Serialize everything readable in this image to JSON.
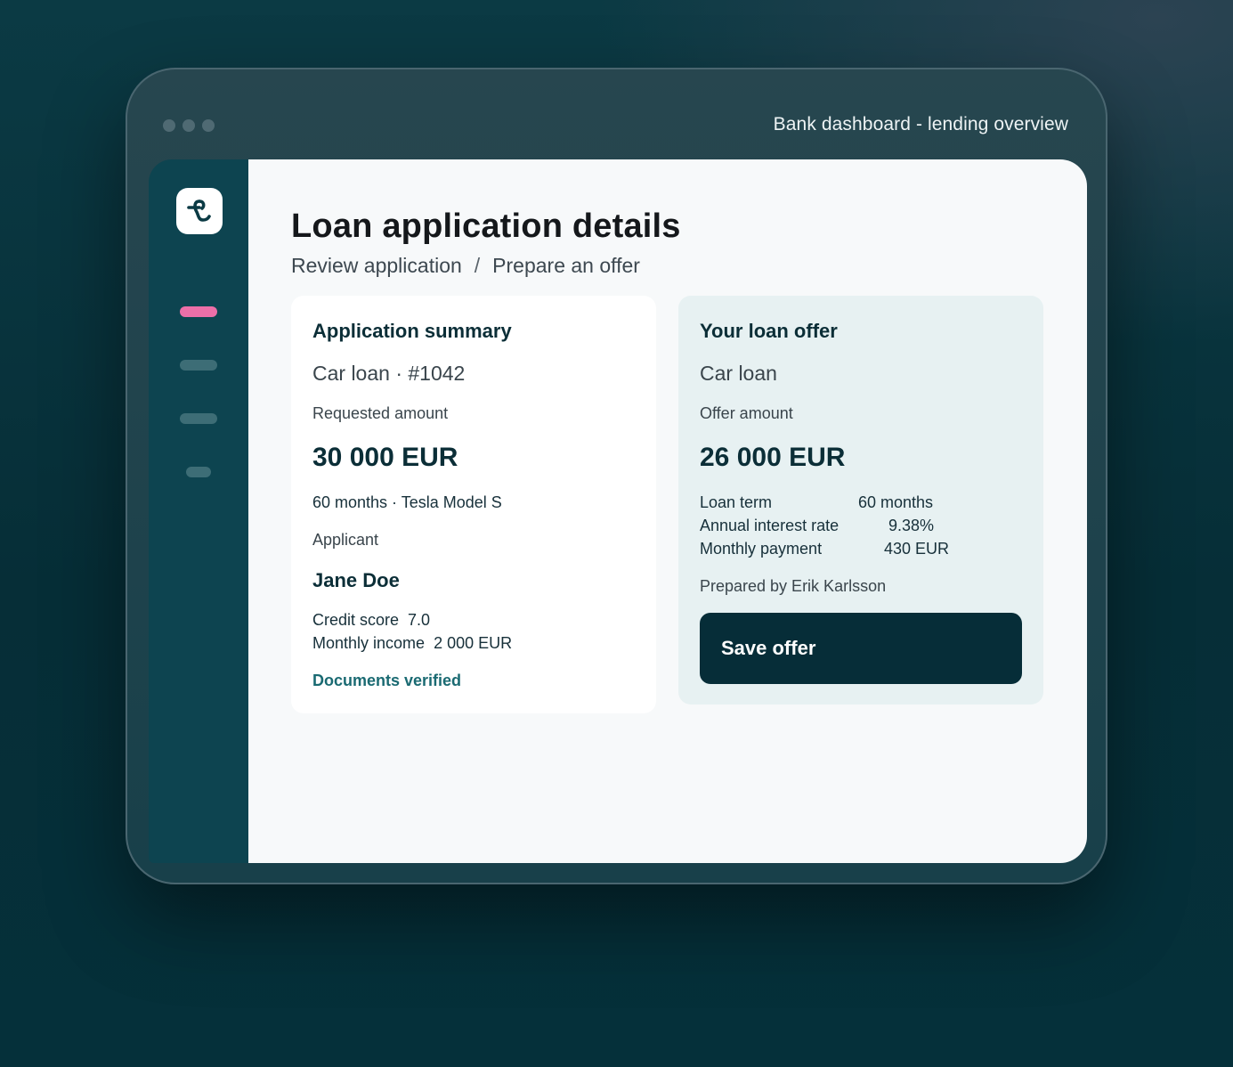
{
  "window": {
    "title": "Bank dashboard - lending overview"
  },
  "sidebar": {
    "logo_icon": "brand-logo-icon",
    "nav_items": [
      {
        "name": "nav-item-1",
        "active": true,
        "color": "#ec6fa8"
      },
      {
        "name": "nav-item-2",
        "active": false,
        "color": "#3d6d76"
      },
      {
        "name": "nav-item-3",
        "active": false,
        "color": "#3d6d76"
      },
      {
        "name": "nav-item-4",
        "active": false,
        "color": "#3d6d76"
      }
    ]
  },
  "page": {
    "title": "Loan application details",
    "breadcrumb": {
      "step1": "Review application",
      "separator": "/",
      "step2": "Prepare an offer"
    }
  },
  "summary": {
    "title": "Application summary",
    "loan_ref": "Car loan · #1042",
    "requested_label": "Requested amount",
    "requested_amount": "30 000 EUR",
    "term_vehicle": "60 months · Tesla Model S",
    "applicant_label": "Applicant",
    "applicant_name": "Jane Doe",
    "credit_score_label": "Credit score",
    "credit_score_value": "7.0",
    "income_label": "Monthly income",
    "income_value": "2 000 EUR",
    "status": "Documents verified"
  },
  "offer": {
    "title": "Your loan offer",
    "loan_type": "Car loan",
    "amount_label": "Offer amount",
    "amount": "26 000 EUR",
    "terms": [
      {
        "label": "Loan term",
        "value": "60 months"
      },
      {
        "label": "Annual interest rate",
        "value": "9.38%"
      },
      {
        "label": "Monthly payment",
        "value": "430 EUR"
      }
    ],
    "prepared_by": "Prepared by Erik Karlsson",
    "save_label": "Save offer"
  },
  "colors": {
    "accent": "#ec6fa8",
    "primary_dark": "#062d38",
    "sidebar": "#0d4450",
    "offer_card_bg": "#e7f1f2",
    "verified": "#1a6a72"
  }
}
